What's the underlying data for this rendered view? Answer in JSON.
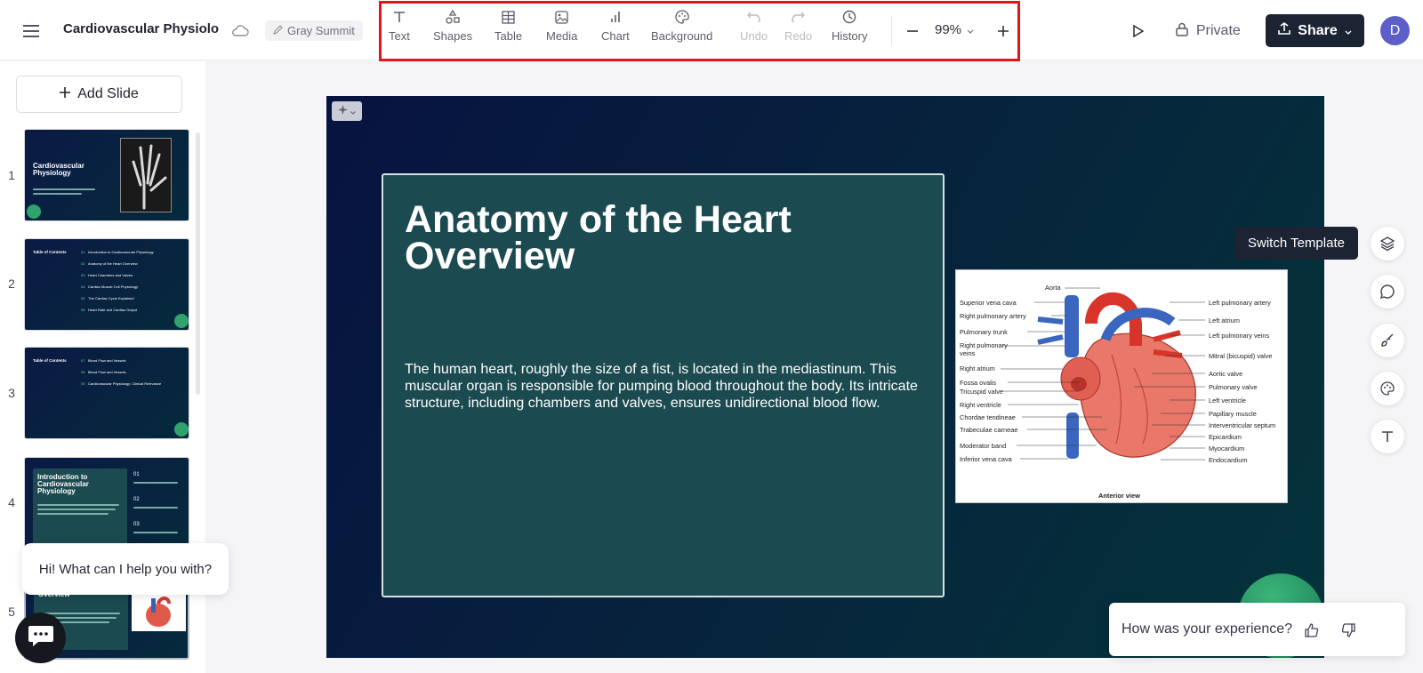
{
  "header": {
    "menu_icon": "hamburger-menu-icon",
    "doc_title": "Cardiovascular Physiolo",
    "cloud_icon": "cloud-icon",
    "workspace_label": "Gray Summit",
    "toolbar": {
      "text": "Text",
      "shapes": "Shapes",
      "table": "Table",
      "media": "Media",
      "chart": "Chart",
      "background": "Background",
      "undo": "Undo",
      "redo": "Redo",
      "history": "History"
    },
    "zoom": "99%",
    "private_label": "Private",
    "share_label": "Share",
    "avatar_initial": "D",
    "highlight_color": "#e2141c"
  },
  "sidebar": {
    "add_slide_label": "Add Slide",
    "slides": [
      {
        "number": "1",
        "title": "Cardiovascular Physiology"
      },
      {
        "number": "2",
        "title": "Table of Contents",
        "items": [
          {
            "n": "01",
            "t": "Introduction to Cardiovascular Physiology"
          },
          {
            "n": "02",
            "t": "Anatomy of the Heart Overview"
          },
          {
            "n": "03",
            "t": "Heart Chambers and Valves"
          },
          {
            "n": "04",
            "t": "Cardiac Muscle Cell Physiology"
          },
          {
            "n": "05",
            "t": "The Cardiac Cycle Explained"
          },
          {
            "n": "06",
            "t": "Heart Rate and Cardiac Output"
          }
        ]
      },
      {
        "number": "3",
        "title": "Table of Contents",
        "items": [
          {
            "n": "07",
            "t": "Blood Flow and Vessels"
          },
          {
            "n": "08",
            "t": "Blood Flow and Vessels"
          },
          {
            "n": "09",
            "t": "Cardiovascular Physiology: Clinical Relevance"
          }
        ]
      },
      {
        "number": "4",
        "title": "Introduction to Cardiovascular Physiology",
        "points": [
          "01",
          "02",
          "03"
        ]
      },
      {
        "number": "5",
        "title": "Overview"
      }
    ]
  },
  "chat": {
    "greeting": "Hi! What can I help you with?"
  },
  "slide": {
    "title": "Anatomy of the Heart Overview",
    "body": "The human heart, roughly the size of a fist, is located in the mediastinum. This muscular organ is responsible for pumping blood throughout the body. Its intricate structure, including chambers and valves, ensures unidirectional blood flow.",
    "diagram_caption": "Anterior view",
    "labels_left": [
      "Superior vena cava",
      "Right pulmonary artery",
      "Pulmonary trunk",
      "Right pulmonary",
      "veins",
      "Right atrium",
      "Fossa ovalis",
      "Tricuspid valve",
      "Right ventricle",
      "Chordae tendineae",
      "Trabeculae carneae",
      "Moderator band",
      "Inferior vena cava"
    ],
    "labels_right": [
      "Left pulmonary artery",
      "Left atrium",
      "Left pulmonary veins",
      "Mitral (bicuspid) valve",
      "Aortic valve",
      "Pulmonary valve",
      "Left ventricle",
      "Papillary muscle",
      "Interventricular septum",
      "Epicardium",
      "Myocardium",
      "Endocardium"
    ],
    "label_top": "Aorta"
  },
  "right_tools": {
    "switch_template_tooltip": "Switch Template",
    "icons": [
      "layers-icon",
      "comment-icon",
      "brush-icon",
      "palette-icon",
      "text-icon"
    ]
  },
  "feedback": {
    "prompt": "How was your experience?"
  }
}
